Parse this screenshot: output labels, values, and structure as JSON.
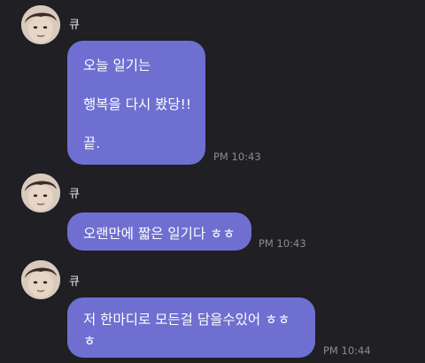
{
  "accent_color": "#6f6fd1",
  "background_color": "#1f1f24",
  "messages": [
    {
      "sender": "큐",
      "avatar_icon": "profile-photo",
      "lines": [
        "오늘 일기는",
        "행복을 다시 봤당!!",
        "끝."
      ],
      "time": "PM 10:43"
    },
    {
      "sender": "큐",
      "avatar_icon": "profile-photo",
      "lines": [
        "오랜만에 짧은 일기다 ㅎㅎ"
      ],
      "time": "PM 10:43"
    },
    {
      "sender": "큐",
      "avatar_icon": "profile-photo",
      "lines": [
        "저 한마디로 모든걸 담을수있어 ㅎㅎ",
        "ㅎ"
      ],
      "time": "PM 10:44"
    }
  ]
}
